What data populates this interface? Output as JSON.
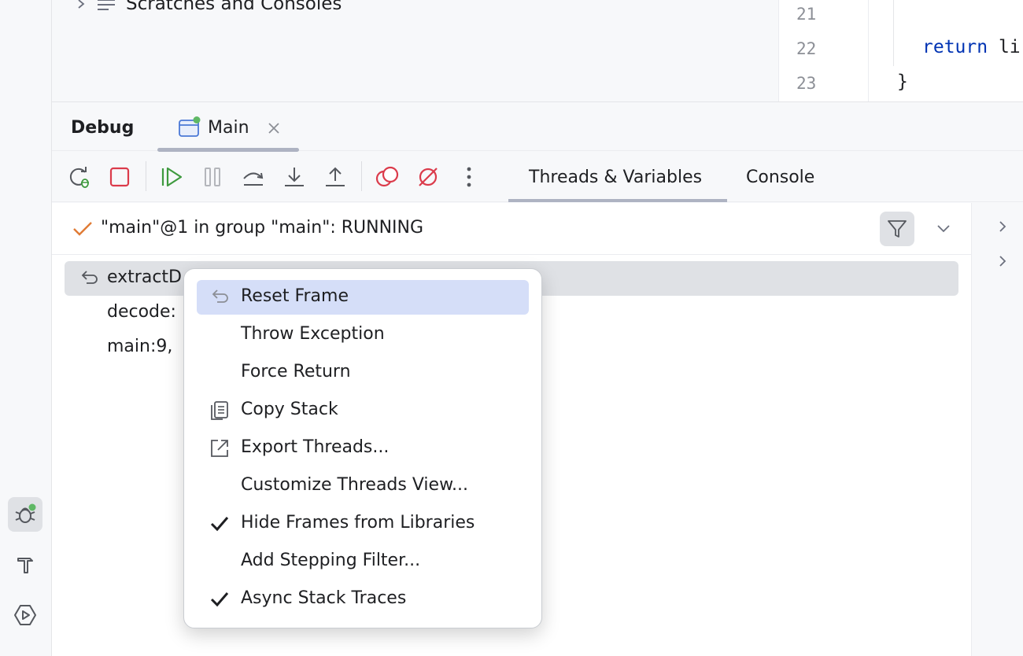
{
  "project": {
    "node_label": "Scratches and Consoles"
  },
  "editor": {
    "lines": [
      {
        "no": "21",
        "code": ""
      },
      {
        "no": "22",
        "keyword": "return",
        "rest": " li"
      },
      {
        "no": "23",
        "code": "}"
      }
    ]
  },
  "debug": {
    "title": "Debug",
    "session_tab": "Main",
    "tabs": [
      "Threads & Variables",
      "Console"
    ],
    "active_tab": "Threads & Variables"
  },
  "thread": {
    "label": "\"main\"@1 in group \"main\": RUNNING",
    "status": "RUNNING"
  },
  "frames": [
    {
      "label": "extractD",
      "selected": true
    },
    {
      "label": "decode:",
      "selected": false
    },
    {
      "label": "main:9,",
      "selected": false
    }
  ],
  "context_menu": {
    "items": [
      {
        "label": "Reset Frame",
        "icon": "reset-frame-icon",
        "highlighted": true
      },
      {
        "label": "Throw Exception"
      },
      {
        "label": "Force Return"
      },
      {
        "label": "Copy Stack",
        "icon": "copy-icon"
      },
      {
        "label": "Export Threads...",
        "icon": "export-icon"
      },
      {
        "label": "Customize Threads View..."
      },
      {
        "label": "Hide Frames from Libraries",
        "checked": true
      },
      {
        "label": "Add Stepping Filter..."
      },
      {
        "label": "Async Stack Traces",
        "checked": true
      }
    ]
  },
  "colors": {
    "accent_highlight": "#d5def8",
    "stop_red": "#db3b4b",
    "resume_green": "#3f9a3f",
    "running_check_orange": "#e07b35",
    "keyword_blue": "#0033b3"
  }
}
